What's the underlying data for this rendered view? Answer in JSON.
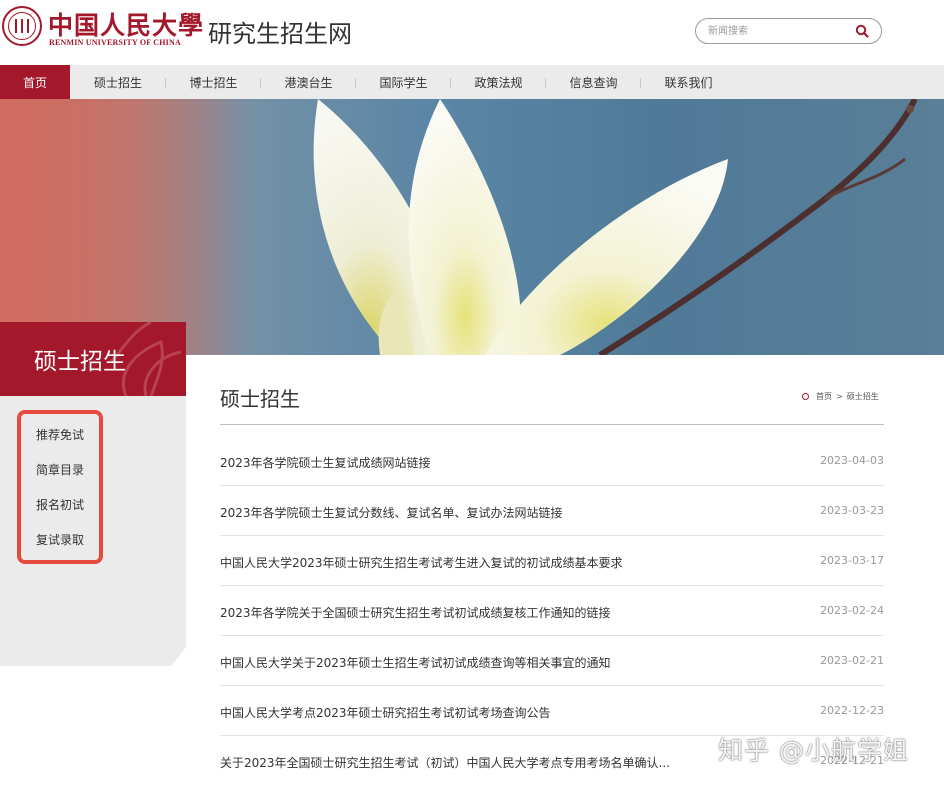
{
  "header": {
    "logo_cn": "中国人民大學",
    "logo_en": "RENMIN UNIVERSITY OF CHINA",
    "site_title": "研究生招生网",
    "search_placeholder": "新闻搜索"
  },
  "nav": {
    "items": [
      {
        "label": "首页",
        "active": true
      },
      {
        "label": "硕士招生"
      },
      {
        "label": "博士招生"
      },
      {
        "label": "港澳台生"
      },
      {
        "label": "国际学生"
      },
      {
        "label": "政策法规"
      },
      {
        "label": "信息查询"
      },
      {
        "label": "联系我们"
      }
    ]
  },
  "sidebar": {
    "title": "硕士招生",
    "items": [
      {
        "label": "推荐免试"
      },
      {
        "label": "简章目录"
      },
      {
        "label": "报名初试"
      },
      {
        "label": "复试录取"
      }
    ]
  },
  "main": {
    "title": "硕士招生",
    "breadcrumb": {
      "home": "首页",
      "sep": ">",
      "current": "硕士招生"
    },
    "news": [
      {
        "title": "2023年各学院硕士生复试成绩网站链接",
        "date": "2023-04-03"
      },
      {
        "title": "2023年各学院硕士生复试分数线、复试名单、复试办法网站链接",
        "date": "2023-03-23"
      },
      {
        "title": "中国人民大学2023年硕士研究生招生考试考生进入复试的初试成绩基本要求",
        "date": "2023-03-17"
      },
      {
        "title": "2023年各学院关于全国硕士研究生招生考试初试成绩复核工作通知的链接",
        "date": "2023-02-24"
      },
      {
        "title": "中国人民大学关于2023年硕士生招生考试初试成绩查询等相关事宜的通知",
        "date": "2023-02-21"
      },
      {
        "title": "中国人民大学考点2023年硕士研究招生考试初试考场查询公告",
        "date": "2022-12-23"
      },
      {
        "title": "关于2023年全国硕士研究生招生考试（初试）中国人民大学考点专用考场名单确认...",
        "date": "2022-12-21"
      }
    ]
  },
  "watermark": "知乎 @小航学姐",
  "colors": {
    "brand": "#a3182a",
    "highlight": "#e8493f",
    "nav_bg": "#ebebeb"
  },
  "icons": {
    "search": "search-icon",
    "logo": "university-seal-icon"
  }
}
